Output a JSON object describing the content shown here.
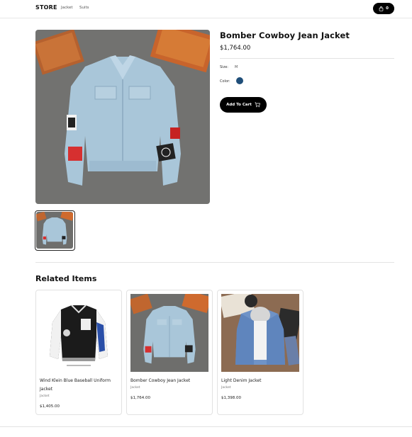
{
  "nav": {
    "brand": "STORE",
    "links": [
      "Jacket",
      "Suits"
    ],
    "cart_count": "0"
  },
  "product": {
    "title": "Bomber Cowboy Jean Jacket",
    "price": "$1,764.00",
    "size_label": "Size:",
    "size_value": "M",
    "color_label": "Color:",
    "color_hex": "#1f4e79",
    "add_to_cart": "Add To Cart"
  },
  "related": {
    "heading": "Related Items",
    "items": [
      {
        "title": "Wind Klein Blue Baseball Uniform Jacket",
        "category": "Jacket",
        "price": "$1,405.00"
      },
      {
        "title": "Bomber Cowboy Jean Jacket",
        "category": "Jacket",
        "price": "$1,764.00"
      },
      {
        "title": "Light Denim Jacket",
        "category": "Jacket",
        "price": "$1,398.00"
      }
    ]
  },
  "colors": {
    "background": "#ffffff",
    "button": "#000000",
    "accent_swatch": "#1f4e79"
  }
}
